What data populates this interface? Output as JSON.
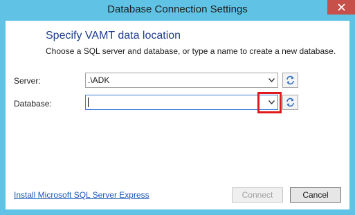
{
  "window": {
    "title": "Database Connection Settings"
  },
  "content": {
    "heading": "Specify VAMT data location",
    "subheading": "Choose a SQL server and database, or type a name to create a new database."
  },
  "server": {
    "label": "Server:",
    "value": ".\\ADK"
  },
  "database": {
    "label": "Database:",
    "value": ""
  },
  "footer": {
    "link_label": "Install Microsoft SQL Server Express",
    "connect_label": "Connect",
    "cancel_label": "Cancel"
  },
  "icons": {
    "close": "close-icon",
    "dropdown": "chevron-down-icon",
    "refresh": "refresh-icon"
  },
  "colors": {
    "frame": "#60c3e6",
    "close": "#c7504a",
    "heading": "#1f3f8f",
    "link": "#1c57b8",
    "highlight": "#e0191f"
  }
}
